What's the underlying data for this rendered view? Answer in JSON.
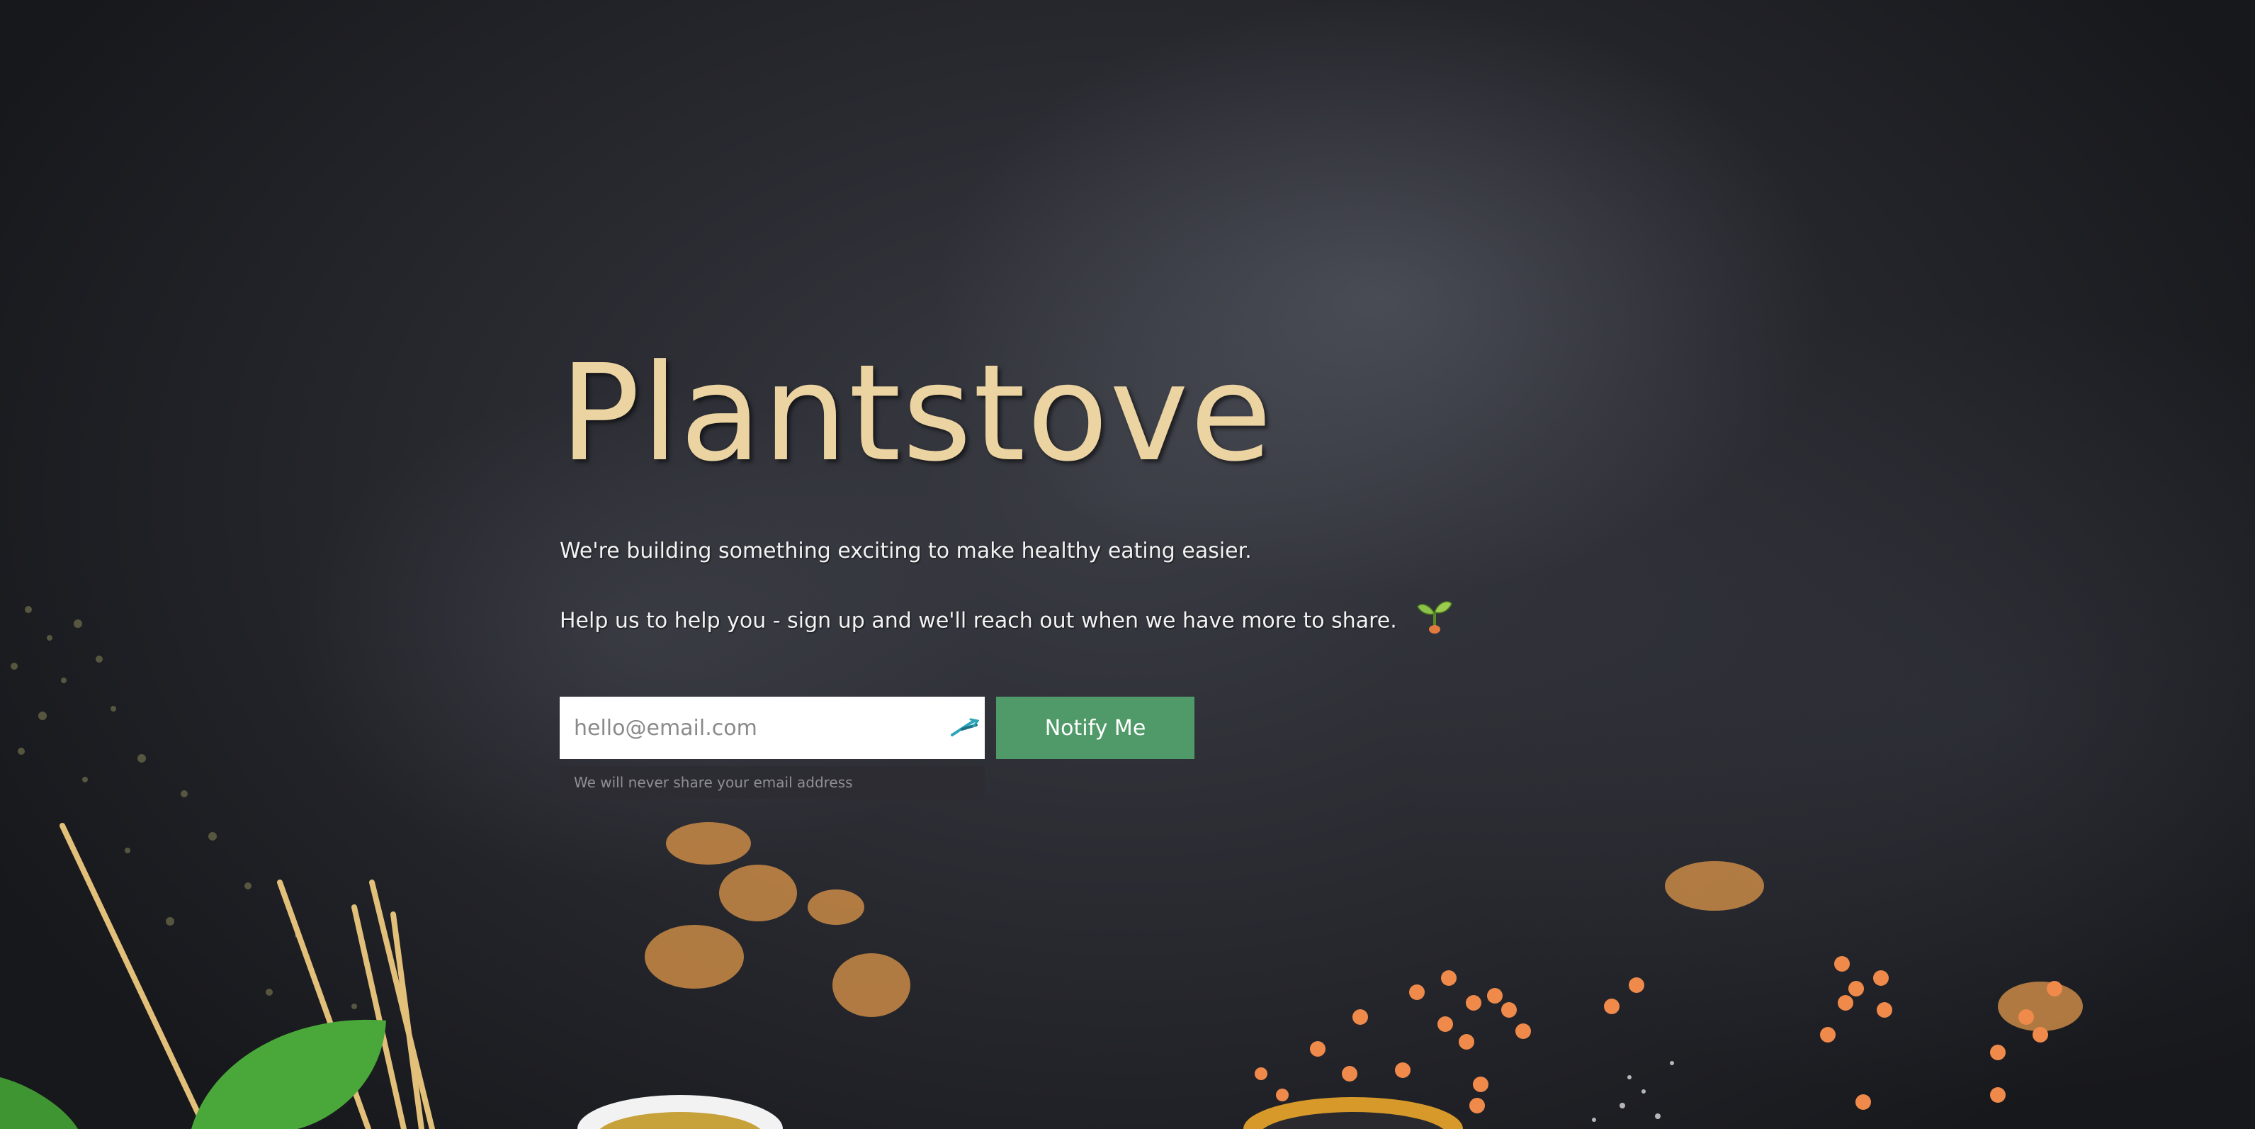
{
  "hero": {
    "brand": "Plantstove",
    "line1": "We're building something exciting to make healthy eating easier.",
    "line2": "Help us to help you - sign up and we'll reach out when we have more to share.",
    "line2_icon": "seedling-icon"
  },
  "signup": {
    "email_placeholder": "hello@email.com",
    "email_value": "",
    "field_icon": "password-manager-icon",
    "button_label": "Notify Me",
    "help_text": "We will never share your email address"
  },
  "colors": {
    "brand": "#ecd3a2",
    "button": "#4f9a68",
    "background": "#27282e"
  }
}
